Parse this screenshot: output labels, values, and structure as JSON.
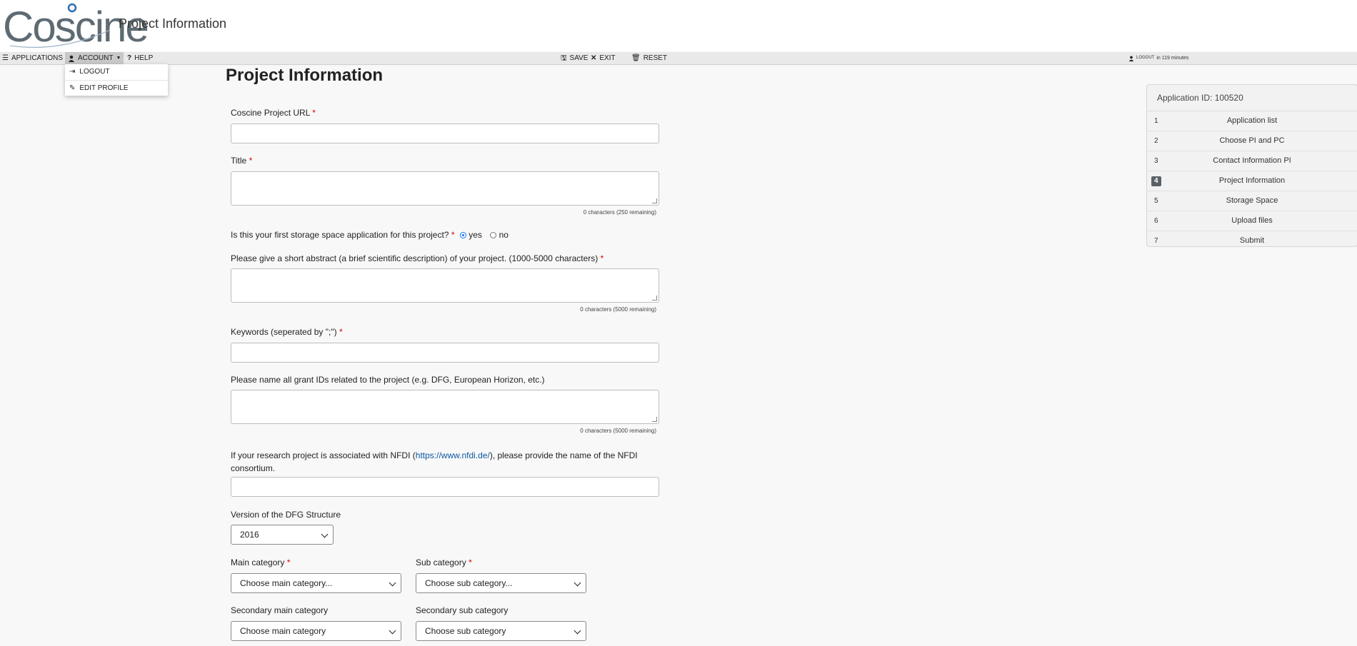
{
  "header": {
    "logo_text": "Coscine",
    "title": "Project Information"
  },
  "menubar": {
    "applications": "APPLICATIONS",
    "account": "ACCOUNT",
    "help": "HELP",
    "save": "SAVE",
    "exit": "EXIT",
    "reset": "RESET",
    "session_logout": "LOGOUT",
    "session_time": "in 119 minutes"
  },
  "account_menu": {
    "logout": "LOGOUT",
    "edit_profile": "EDIT PROFILE"
  },
  "form": {
    "page_title": "Project Information",
    "url_label": "Coscine Project URL",
    "title_label": "Title",
    "title_counter": "0 characters (250 remaining)",
    "first_app_label": "Is this your first storage space application for this project?",
    "first_app_yes": "yes",
    "first_app_no": "no",
    "abstract_label": "Please give a short abstract (a brief scientific description) of your project. (1000-5000 characters)",
    "abstract_counter": "0 characters (5000 remaining)",
    "keywords_label": "Keywords (seperated by \";\")",
    "grants_label": "Please name all grant IDs related to the project (e.g. DFG, European Horizon, etc.)",
    "grants_counter": "0 characters (5000 remaining)",
    "nfdi_label_pre": "If your research project is associated with NFDI (",
    "nfdi_link": "https://www.nfdi.de/",
    "nfdi_label_post": "), please provide the name of the NFDI",
    "nfdi_label_line2": "consortium.",
    "dfg_version_label": "Version of the DFG Structure",
    "dfg_version_value": "2016",
    "main_cat_label": "Main category",
    "main_cat_value": "Choose main category...",
    "sub_cat_label": "Sub category",
    "sub_cat_value": "Choose sub category...",
    "sec_main_cat_label": "Secondary main category",
    "sec_main_cat_value": "Choose main category",
    "sec_sub_cat_label": "Secondary sub category",
    "sec_sub_cat_value": "Choose sub category",
    "required_mark": "*"
  },
  "sidebar": {
    "heading": "Application ID: 100520",
    "steps": [
      {
        "num": "1",
        "label": "Application list"
      },
      {
        "num": "2",
        "label": "Choose PI and PC"
      },
      {
        "num": "3",
        "label": "Contact Information PI"
      },
      {
        "num": "4",
        "label": "Project Information",
        "active": true
      },
      {
        "num": "5",
        "label": "Storage Space"
      },
      {
        "num": "6",
        "label": "Upload files"
      },
      {
        "num": "7",
        "label": "Submit"
      }
    ]
  },
  "colors": {
    "accent": "#0d6efd",
    "required": "#dd0000",
    "link": "#0b57a4"
  }
}
